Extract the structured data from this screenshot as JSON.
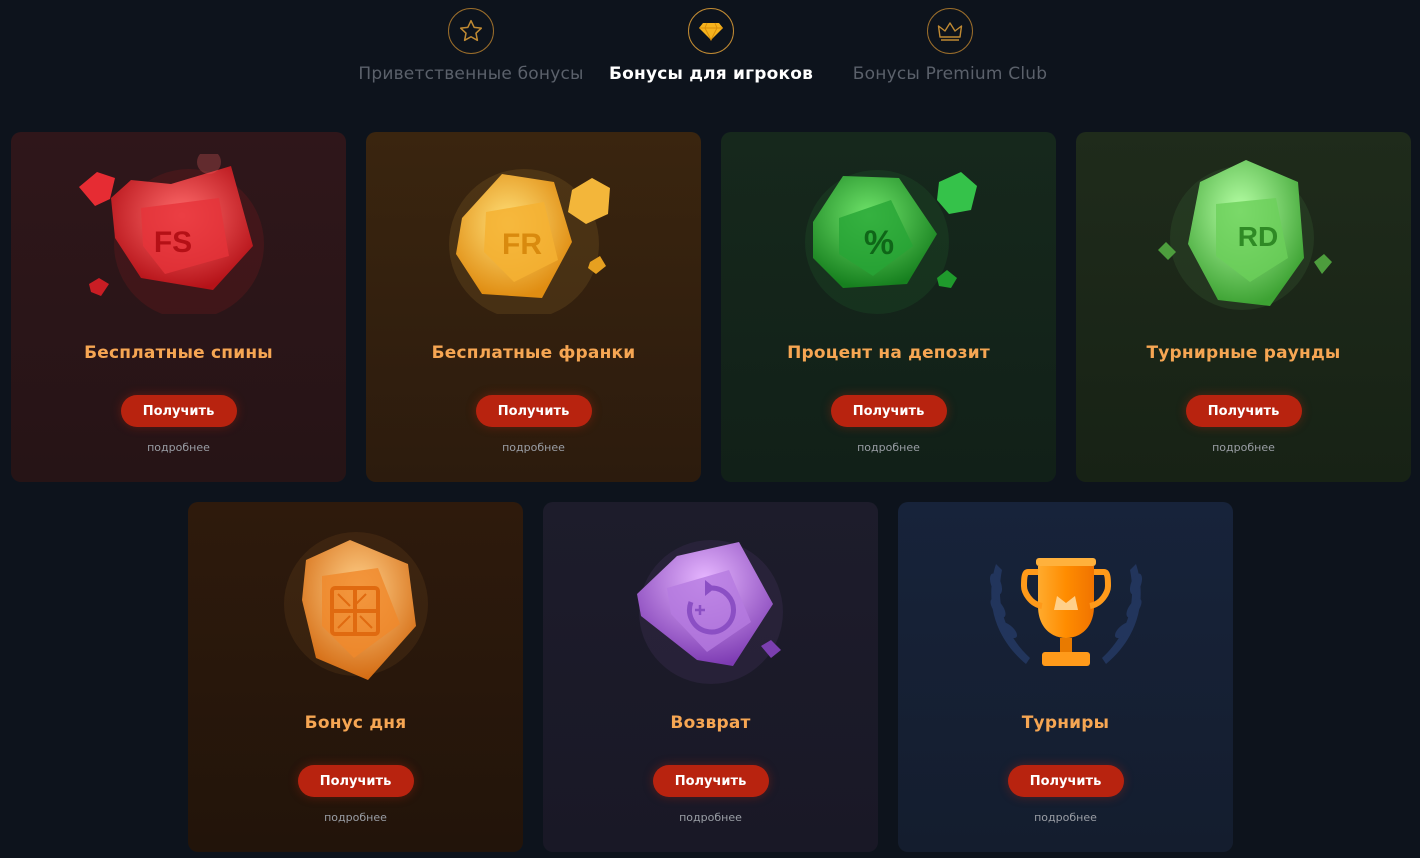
{
  "tabs": [
    {
      "label": "Приветственные бонусы",
      "icon": "star-icon",
      "active": false
    },
    {
      "label": "Бонусы для игроков",
      "icon": "diamond-icon",
      "active": true
    },
    {
      "label": "Бонусы Premium Club",
      "icon": "crown-icon",
      "active": false
    }
  ],
  "cards": [
    {
      "title": "Бесплатные спины",
      "badge": "FS",
      "icon": "red-gem-fs-icon",
      "button": "Получить",
      "more": "подробнее",
      "bg": "#2b1619"
    },
    {
      "title": "Бесплатные франки",
      "badge": "FR",
      "icon": "yellow-gem-fr-icon",
      "button": "Получить",
      "more": "подробнее",
      "bg": "#33220f"
    },
    {
      "title": "Процент на депозит",
      "badge": "%",
      "icon": "green-gem-percent-icon",
      "button": "Получить",
      "more": "подробнее",
      "bg": "#142519"
    },
    {
      "title": "Турнирные раунды",
      "badge": "RD",
      "icon": "lightgreen-gem-rd-icon",
      "button": "Получить",
      "more": "подробнее",
      "bg": "#1b2718"
    },
    {
      "title": "Бонус дня",
      "badge": "",
      "icon": "orange-gem-gift-icon",
      "button": "Получить",
      "more": "подробнее",
      "bg": "#2a170c"
    },
    {
      "title": "Возврат",
      "badge": "",
      "icon": "purple-gem-cashback-icon",
      "button": "Получить",
      "more": "подробнее",
      "bg": "#1b1b29"
    },
    {
      "title": "Турниры",
      "badge": "",
      "icon": "trophy-icon",
      "button": "Получить",
      "more": "подробнее",
      "bg": "#162032"
    }
  ],
  "colors": {
    "page_bg": "#0d131c",
    "title_orange": "#f6a653",
    "button_red": "#b8230f",
    "tab_icon_gold": "#c08a33"
  }
}
